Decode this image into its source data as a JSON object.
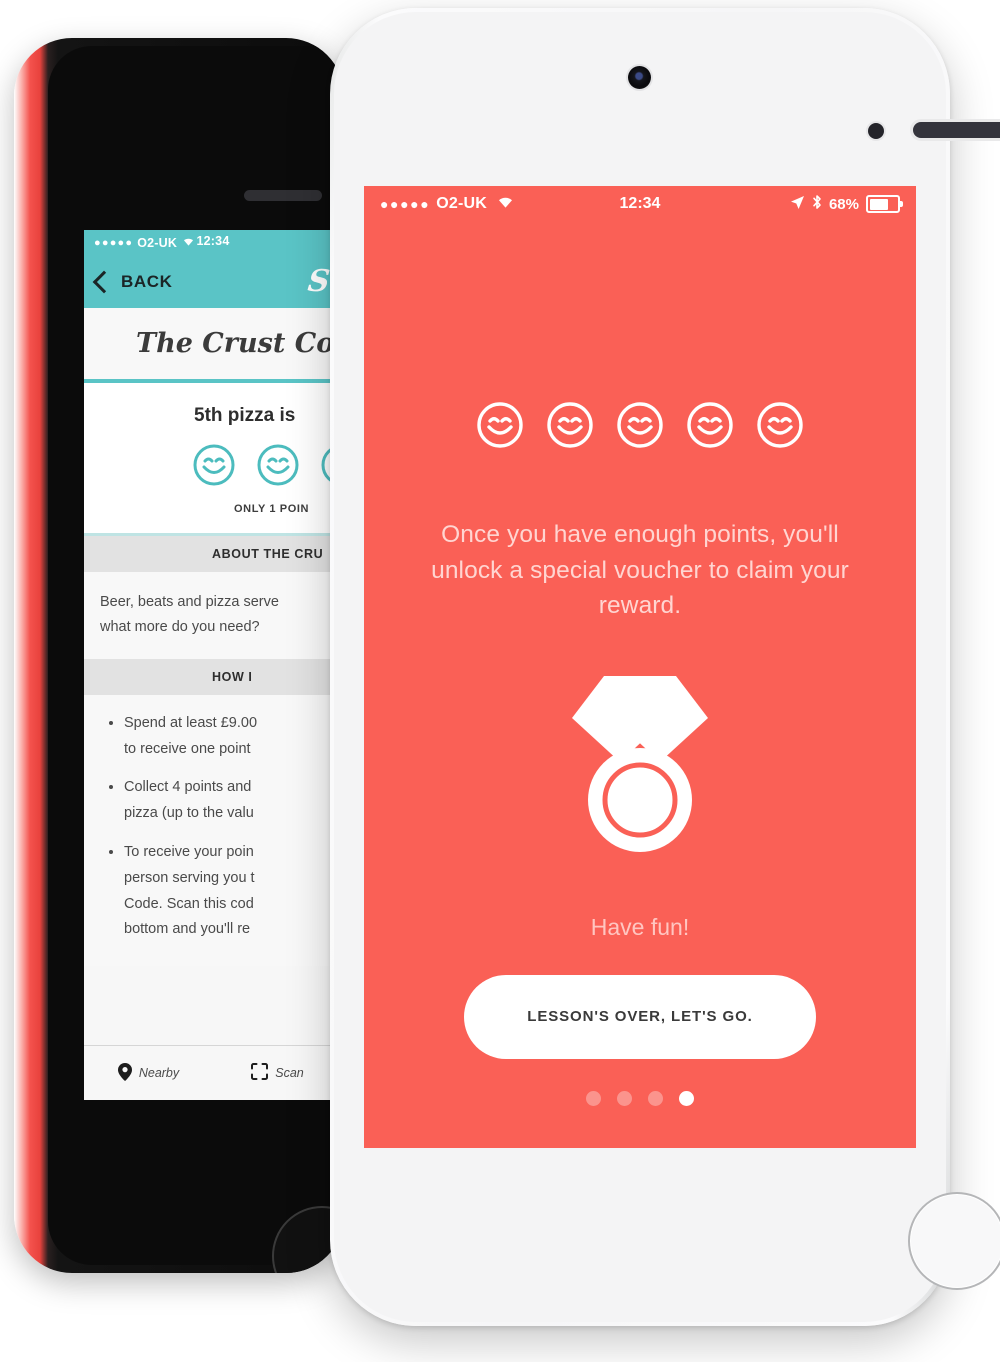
{
  "back_phone": {
    "status_bar": {
      "signal": "●●●●●",
      "carrier": "O2-UK",
      "wifi_icon": "wifi-icon",
      "time": "12:34"
    },
    "nav": {
      "back_label": "BACK",
      "back_icon": "chevron-left-icon",
      "logo": "Sc"
    },
    "title": "The Crust Co",
    "reward": {
      "headline": "5th pizza is",
      "stamps": 3,
      "points_note": "ONLY 1 POIN"
    },
    "sections": [
      {
        "heading": "ABOUT THE CRU",
        "body_lines": [
          "Beer, beats and pizza serve",
          "what more do you need?"
        ]
      },
      {
        "heading": "HOW I",
        "bullets": [
          [
            "Spend at least £9.00",
            "to receive one point"
          ],
          [
            "Collect 4 points and",
            "pizza (up to the valu"
          ],
          [
            "To receive your poin",
            "person serving you t",
            "Code. Scan this cod",
            "bottom and you'll re"
          ]
        ]
      }
    ],
    "tabs": [
      {
        "label": "Nearby",
        "icon": "map-pin-icon"
      },
      {
        "label": "Scan",
        "icon": "scan-frame-icon"
      }
    ]
  },
  "front_phone": {
    "status_bar": {
      "signal": "●●●●●",
      "carrier": "O2-UK",
      "wifi_icon": "wifi-icon",
      "time": "12:34",
      "location_icon": "location-arrow-icon",
      "bluetooth_icon": "bluetooth-icon",
      "battery_percent": "68%",
      "battery_icon": "battery-icon"
    },
    "onboarding": {
      "stamps": 5,
      "stamp_icon": "smiley-face-icon",
      "body_text": "Once you have enough points, you'll unlock a special voucher to claim your reward.",
      "medal_icon": "medal-icon",
      "closing_text": "Have fun!",
      "cta_label": "LESSON'S OVER, LET'S GO.",
      "page_count": 4,
      "active_page": 4
    }
  },
  "colors": {
    "brand_red": "#FA6056",
    "brand_teal": "#5AC4C6",
    "text_on_red": "#FFD5D1",
    "white": "#FFFFFF"
  }
}
